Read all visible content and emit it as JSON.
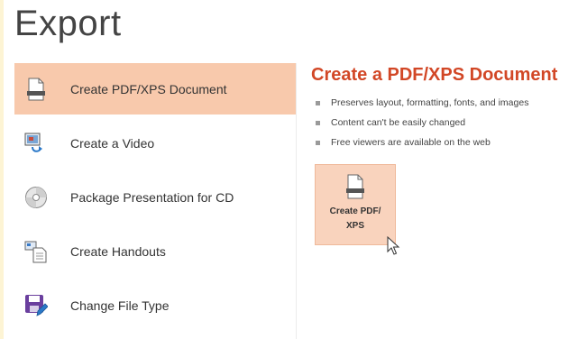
{
  "page": {
    "title": "Export"
  },
  "sidebar": {
    "items": [
      {
        "label": "Create PDF/XPS Document",
        "icon": "pdf-document-icon",
        "selected": true
      },
      {
        "label": "Create a Video",
        "icon": "video-icon",
        "selected": false
      },
      {
        "label": "Package Presentation for CD",
        "icon": "cd-icon",
        "selected": false
      },
      {
        "label": "Create Handouts",
        "icon": "handouts-icon",
        "selected": false
      },
      {
        "label": "Change File Type",
        "icon": "save-file-icon",
        "selected": false
      }
    ]
  },
  "detail": {
    "heading": "Create a PDF/XPS Document",
    "bullets": [
      "Preserves layout, formatting, fonts, and images",
      "Content can't be easily changed",
      "Free viewers are available on the web"
    ],
    "action_button": {
      "label_line1": "Create PDF/",
      "label_line2": "XPS",
      "icon": "pdf-document-icon"
    }
  },
  "colors": {
    "accent": "#d24726",
    "selected_bg": "#f8c9ac",
    "button_bg": "#f9d3bd",
    "window_edge": "#fdf4d4"
  }
}
